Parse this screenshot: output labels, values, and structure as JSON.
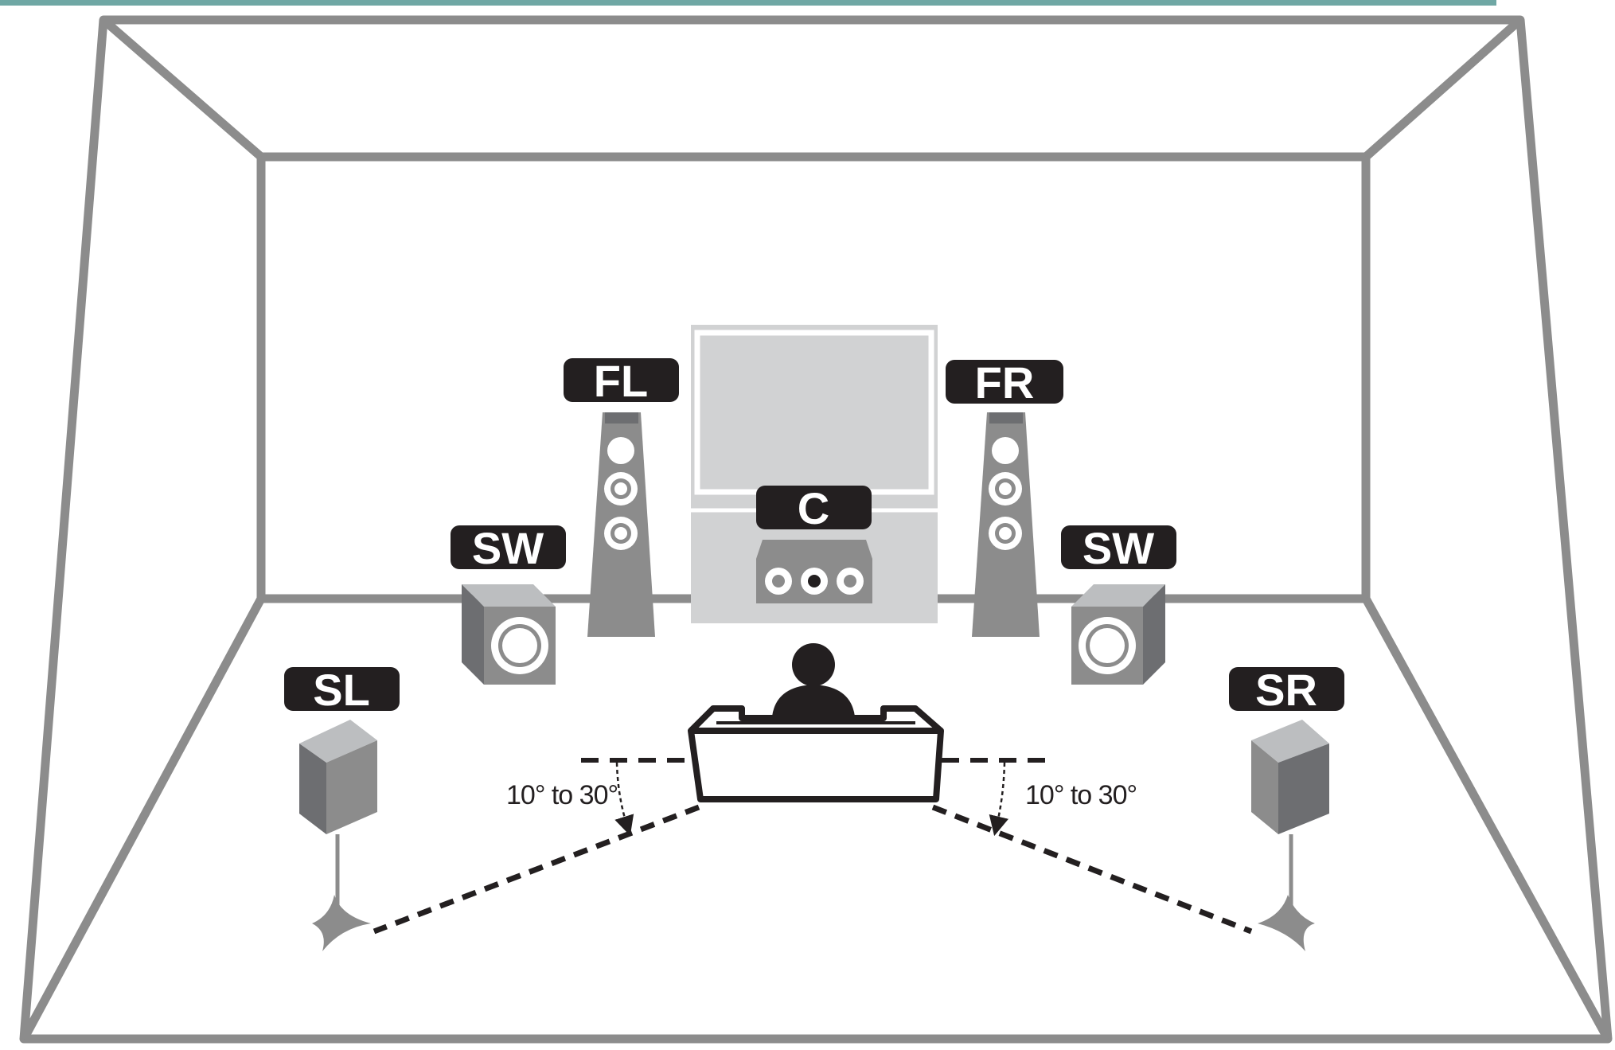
{
  "colors": {
    "label_bg": "#231f20",
    "label_text": "#ffffff",
    "room_line": "#8c8c8c",
    "speaker_fill": "#8c8c8c",
    "screen_fill": "#d1d2d3",
    "top_strip": "#6fa7a4"
  },
  "labels": {
    "front_left": "FL",
    "front_right": "FR",
    "center": "C",
    "subwoofer_left": "SW",
    "subwoofer_right": "SW",
    "surround_left": "SL",
    "surround_right": "SR"
  },
  "angles": {
    "left": "10° to 30°",
    "right": "10° to 30°"
  },
  "icons": {
    "listener": "person-icon",
    "sofa": "sofa-icon",
    "tv": "tv-screen-icon"
  }
}
